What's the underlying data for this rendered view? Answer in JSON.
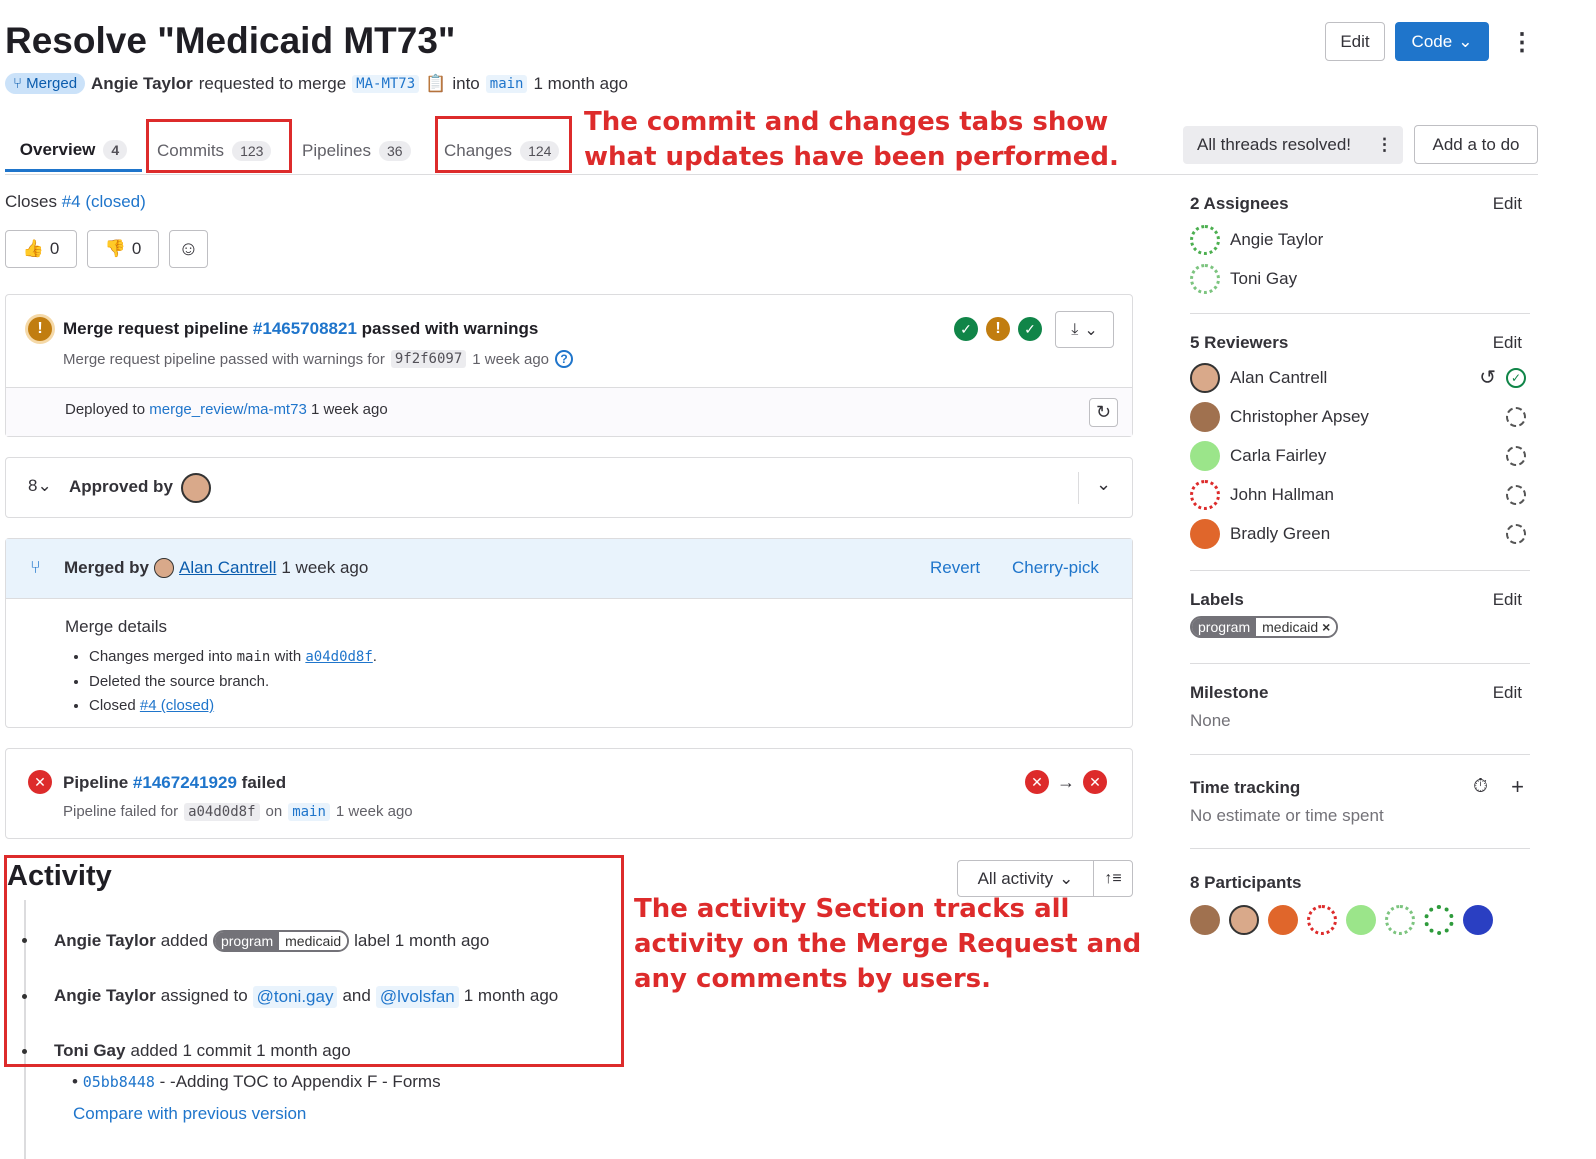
{
  "header": {
    "title": "Resolve \"Medicaid MT73\"",
    "status": "Merged",
    "author": "Angie Taylor",
    "requested_text": "requested to merge",
    "source_branch": "MA-MT73",
    "into_text": "into",
    "target_branch": "main",
    "time": "1 month ago",
    "edit_label": "Edit",
    "code_label": "Code"
  },
  "tabs": [
    {
      "label": "Overview",
      "count": "4"
    },
    {
      "label": "Commits",
      "count": "123"
    },
    {
      "label": "Pipelines",
      "count": "36"
    },
    {
      "label": "Changes",
      "count": "124"
    }
  ],
  "threads": {
    "label": "All threads resolved!",
    "todo_label": "Add a to do"
  },
  "annotations": {
    "tabs": "The commit and changes tabs show what updates have been performed.",
    "activity": "The activity Section tracks all activity on the Merge Request and any comments by users."
  },
  "closes": {
    "prefix": "Closes",
    "link": "#4 (closed)"
  },
  "reactions": {
    "thumbs_up": "0",
    "thumbs_down": "0"
  },
  "pipeline": {
    "title_prefix": "Merge request pipeline",
    "id": "#1465708821",
    "title_suffix": "passed with warnings",
    "sub_prefix": "Merge request pipeline passed with warnings for",
    "sha": "9f2f6097",
    "time": "1 week ago",
    "deployed_prefix": "Deployed to",
    "env": "merge_review/ma-mt73",
    "deployed_time": "1 week ago"
  },
  "approval": {
    "label": "Approved by"
  },
  "merged": {
    "prefix": "Merged by",
    "user": "Alan Cantrell",
    "time": "1 week ago",
    "revert": "Revert",
    "cherry": "Cherry-pick",
    "details_title": "Merge details",
    "d1_prefix": "Changes merged into",
    "d1_branch": "main",
    "d1_with": "with",
    "d1_sha": "a04d0d8f",
    "d1_end": ".",
    "d2": "Deleted the source branch.",
    "d3_prefix": "Closed",
    "d3_link": "#4 (closed)"
  },
  "pipeline2": {
    "prefix": "Pipeline",
    "id": "#1467241929",
    "suffix": "failed",
    "sub_prefix": "Pipeline failed for",
    "sha": "a04d0d8f",
    "on": "on",
    "branch": "main",
    "time": "1 week ago"
  },
  "activity": {
    "title": "Activity",
    "filter": "All activity",
    "items": [
      {
        "user": "Angie Taylor",
        "action": "added",
        "label_key": "program",
        "label_val": "medicaid",
        "after": "label 1 month ago"
      },
      {
        "user": "Angie Taylor",
        "action": "assigned to",
        "m1": "@toni.gay",
        "and": "and",
        "m2": "@lvolsfan",
        "time": "1 month ago"
      },
      {
        "user": "Toni Gay",
        "action": "added 1 commit 1 month ago",
        "sha": "05bb8448",
        "msg": "- -Adding TOC to Appendix F - Forms",
        "compare": "Compare with previous version"
      }
    ]
  },
  "sidebar": {
    "assignees": {
      "title": "2 Assignees",
      "edit": "Edit",
      "people": [
        "Angie Taylor",
        "Toni Gay"
      ]
    },
    "reviewers": {
      "title": "5 Reviewers",
      "edit": "Edit",
      "people": [
        "Alan Cantrell",
        "Christopher Apsey",
        "Carla Fairley",
        "John Hallman",
        "Bradly Green"
      ]
    },
    "labels": {
      "title": "Labels",
      "edit": "Edit",
      "key": "program",
      "val": "medicaid"
    },
    "milestone": {
      "title": "Milestone",
      "edit": "Edit",
      "value": "None"
    },
    "time": {
      "title": "Time tracking",
      "value": "No estimate or time spent"
    },
    "participants": {
      "title": "8 Participants"
    }
  },
  "colors": {
    "link": "#1f75cb",
    "success": "#108548",
    "warning": "#c17d10",
    "danger": "#dd2b2b",
    "primary": "#1f75cb"
  }
}
